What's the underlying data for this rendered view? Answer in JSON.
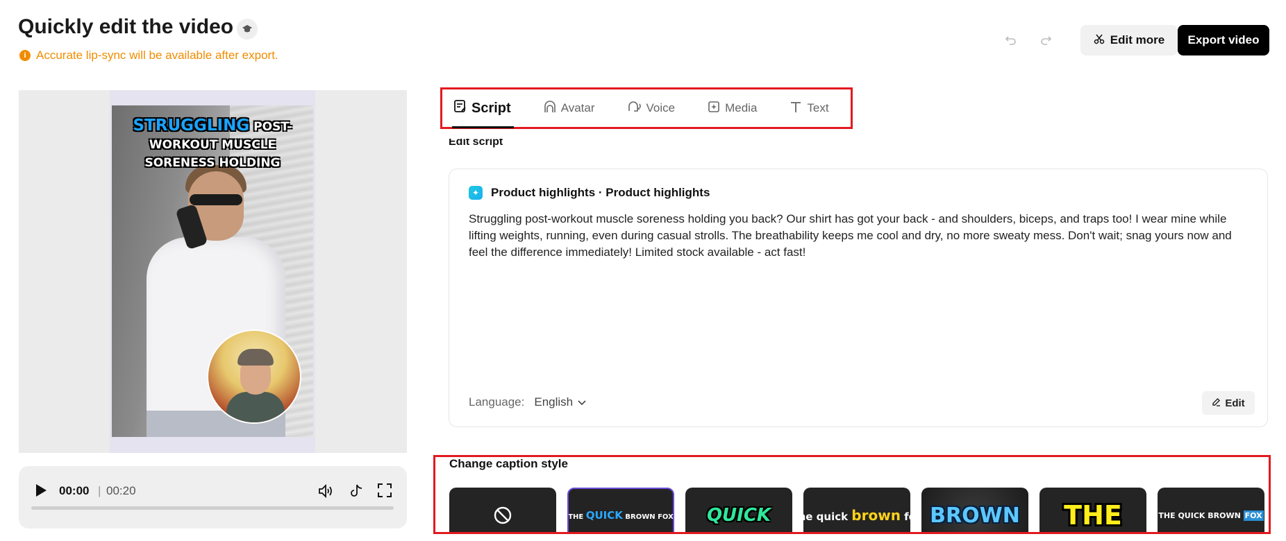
{
  "header": {
    "title": "Quickly edit the video",
    "warning": "Accurate lip-sync will be available after export.",
    "edit_more_label": "Edit more",
    "export_label": "Export video"
  },
  "preview": {
    "caption_highlight": "STRUGGLING",
    "caption_rest_1": "POST-",
    "caption_line_2": "WORKOUT MUSCLE",
    "caption_line_3": "SORENESS HOLDING"
  },
  "player": {
    "current_time": "00:00",
    "separator": "|",
    "total_time": "00:20",
    "progress": 0
  },
  "tabs": [
    {
      "label": "Script",
      "icon": "script-icon",
      "active": true
    },
    {
      "label": "Avatar",
      "icon": "avatar-icon",
      "active": false
    },
    {
      "label": "Voice",
      "icon": "voice-icon",
      "active": false
    },
    {
      "label": "Media",
      "icon": "media-icon",
      "active": false
    },
    {
      "label": "Text",
      "icon": "text-icon",
      "active": false
    }
  ],
  "script": {
    "section_title": "Edit script",
    "heading": "Product highlights · Product highlights",
    "body": "Struggling post-workout muscle soreness holding you back? Our shirt has got your back - and shoulders, biceps, and traps too! I wear mine while lifting weights, running, even during casual strolls. The breathability keeps me cool and dry, no more sweaty mess. Don't wait; snag yours now and feel the difference immediately! Limited stock available - act fast!",
    "language_label": "Language:",
    "language_value": "English",
    "edit_label": "Edit"
  },
  "captions": {
    "title": "Change caption style",
    "styles": [
      {
        "name": "none",
        "icon": "no-caption-icon"
      },
      {
        "name": "quick-blue",
        "text_a": "THE ",
        "text_b": "QUICK",
        "text_c": " BROWN FOX"
      },
      {
        "name": "quick-green",
        "text": "QUICK"
      },
      {
        "name": "brown-yellow",
        "text_a": "The quick ",
        "text_b": "brown",
        "text_c": " fox"
      },
      {
        "name": "brown-blue",
        "text": "BROWN"
      },
      {
        "name": "the-yellow",
        "text": "THE"
      },
      {
        "name": "fox-box",
        "text_a": "THE QUICK BROWN ",
        "text_b": "FOX"
      }
    ]
  },
  "colors": {
    "accent_red": "#e2191f",
    "warning": "#f08c00",
    "export_bg": "#000000",
    "selected_border": "#6b4bd8"
  }
}
